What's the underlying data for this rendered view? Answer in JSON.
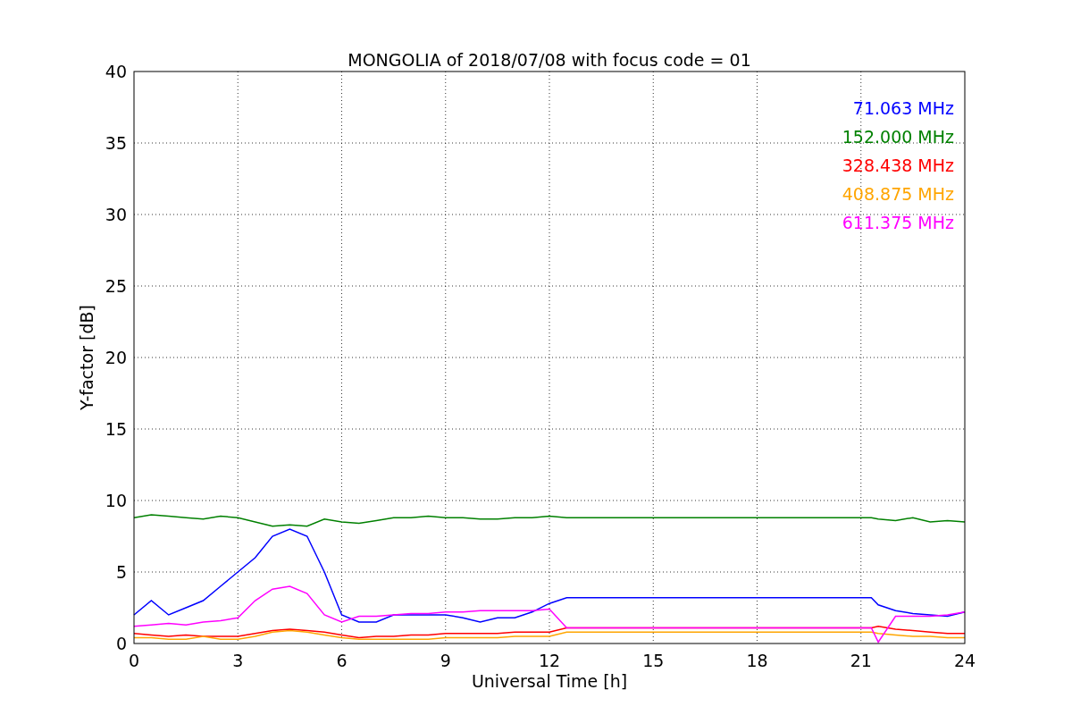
{
  "chart_data": {
    "type": "line",
    "title": "MONGOLIA of 2018/07/08 with focus code = 01",
    "xlabel": "Universal Time [h]",
    "ylabel": "Y-factor [dB]",
    "x": [
      0,
      0.5,
      1,
      1.5,
      2,
      2.5,
      3,
      3.5,
      4,
      4.5,
      5,
      5.5,
      6,
      6.5,
      7,
      7.5,
      8,
      8.5,
      9,
      9.5,
      10,
      10.5,
      11,
      11.5,
      12,
      12.5,
      21.3,
      21.5,
      22,
      22.5,
      23,
      23.5,
      24
    ],
    "series": [
      {
        "name": "71.063 MHz",
        "color": "#0000ff",
        "values": [
          2,
          3,
          2,
          2.5,
          3,
          4,
          5,
          6,
          7.5,
          8,
          7.5,
          5,
          2,
          1.5,
          1.5,
          2,
          2,
          2,
          2,
          1.8,
          1.5,
          1.8,
          1.8,
          2.2,
          2.8,
          3.2,
          3.2,
          2.7,
          2.3,
          2.1,
          2,
          1.9,
          2.2
        ]
      },
      {
        "name": "152.000 MHz",
        "color": "#008000",
        "values": [
          8.8,
          9,
          8.9,
          8.8,
          8.7,
          8.9,
          8.8,
          8.5,
          8.2,
          8.3,
          8.2,
          8.7,
          8.5,
          8.4,
          8.6,
          8.8,
          8.8,
          8.9,
          8.8,
          8.8,
          8.7,
          8.7,
          8.8,
          8.8,
          8.9,
          8.8,
          8.8,
          8.7,
          8.6,
          8.8,
          8.5,
          8.6,
          8.5
        ]
      },
      {
        "name": "328.438 MHz",
        "color": "#ff0000",
        "values": [
          0.7,
          0.6,
          0.5,
          0.6,
          0.5,
          0.5,
          0.5,
          0.7,
          0.9,
          1,
          0.9,
          0.8,
          0.6,
          0.4,
          0.5,
          0.5,
          0.6,
          0.6,
          0.7,
          0.7,
          0.7,
          0.7,
          0.8,
          0.8,
          0.8,
          1.1,
          1.1,
          1.2,
          1,
          0.9,
          0.8,
          0.7,
          0.7
        ]
      },
      {
        "name": "408.875 MHz",
        "color": "#ffa500",
        "values": [
          0.4,
          0.4,
          0.3,
          0.3,
          0.5,
          0.3,
          0.3,
          0.5,
          0.8,
          0.9,
          0.8,
          0.6,
          0.4,
          0.3,
          0.3,
          0.3,
          0.3,
          0.3,
          0.4,
          0.4,
          0.4,
          0.4,
          0.5,
          0.5,
          0.5,
          0.8,
          0.8,
          0.7,
          0.6,
          0.5,
          0.5,
          0.4,
          0.4
        ]
      },
      {
        "name": "611.375 MHz",
        "color": "#ff00ff",
        "values": [
          1.2,
          1.3,
          1.4,
          1.3,
          1.5,
          1.6,
          1.8,
          3,
          3.8,
          4,
          3.5,
          2,
          1.5,
          1.9,
          1.9,
          2,
          2.1,
          2.1,
          2.2,
          2.2,
          2.3,
          2.3,
          2.3,
          2.3,
          2.4,
          1.1,
          1.1,
          0.1,
          1.9,
          1.9,
          1.9,
          2,
          2.2
        ]
      }
    ],
    "grid": true,
    "xlim": [
      0,
      24
    ],
    "ylim": [
      0,
      40
    ],
    "xticks": [
      0,
      3,
      6,
      9,
      12,
      15,
      18,
      21,
      24
    ],
    "yticks": [
      0,
      5,
      10,
      15,
      20,
      25,
      30,
      35,
      40
    ]
  }
}
